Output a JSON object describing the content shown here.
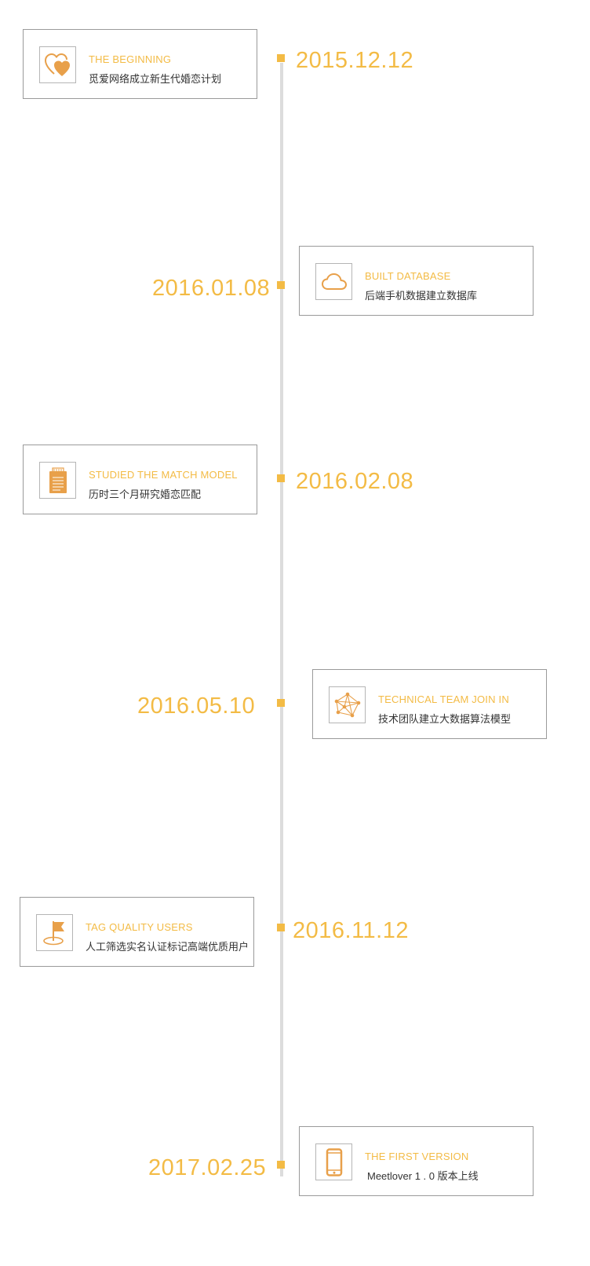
{
  "colors": {
    "accent": "#f3bb45",
    "icon": "#e8a04a",
    "border": "#9a9a9a",
    "axis": "#dcdcdc",
    "text": "#333333"
  },
  "events": [
    {
      "date": "2015.12.12",
      "title": "THE BEGINNING",
      "subtitle": "觅爱网络成立新生代婚恋计划",
      "icon": "hearts-icon"
    },
    {
      "date": "2016.01.08",
      "title": "BUILT DATABASE",
      "subtitle": "后端手机数据建立数据库",
      "icon": "cloud-icon"
    },
    {
      "date": "2016.02.08",
      "title": "STUDIED THE MATCH MODEL",
      "subtitle": "历时三个月研究婚恋匹配",
      "icon": "notepad-icon"
    },
    {
      "date": "2016.05.10",
      "title": "TECHNICAL TEAM JOIN IN",
      "subtitle": "技术团队建立大数据算法模型",
      "icon": "network-icon"
    },
    {
      "date": "2016.11.12",
      "title": "TAG QUALITY USERS",
      "subtitle": "人工筛选实名认证标记高端优质用户",
      "icon": "flag-icon"
    },
    {
      "date": "2017.02.25",
      "title": "THE FIRST VERSION",
      "subtitle": "Meetlover 1 . 0 版本上线",
      "icon": "phone-icon"
    }
  ]
}
